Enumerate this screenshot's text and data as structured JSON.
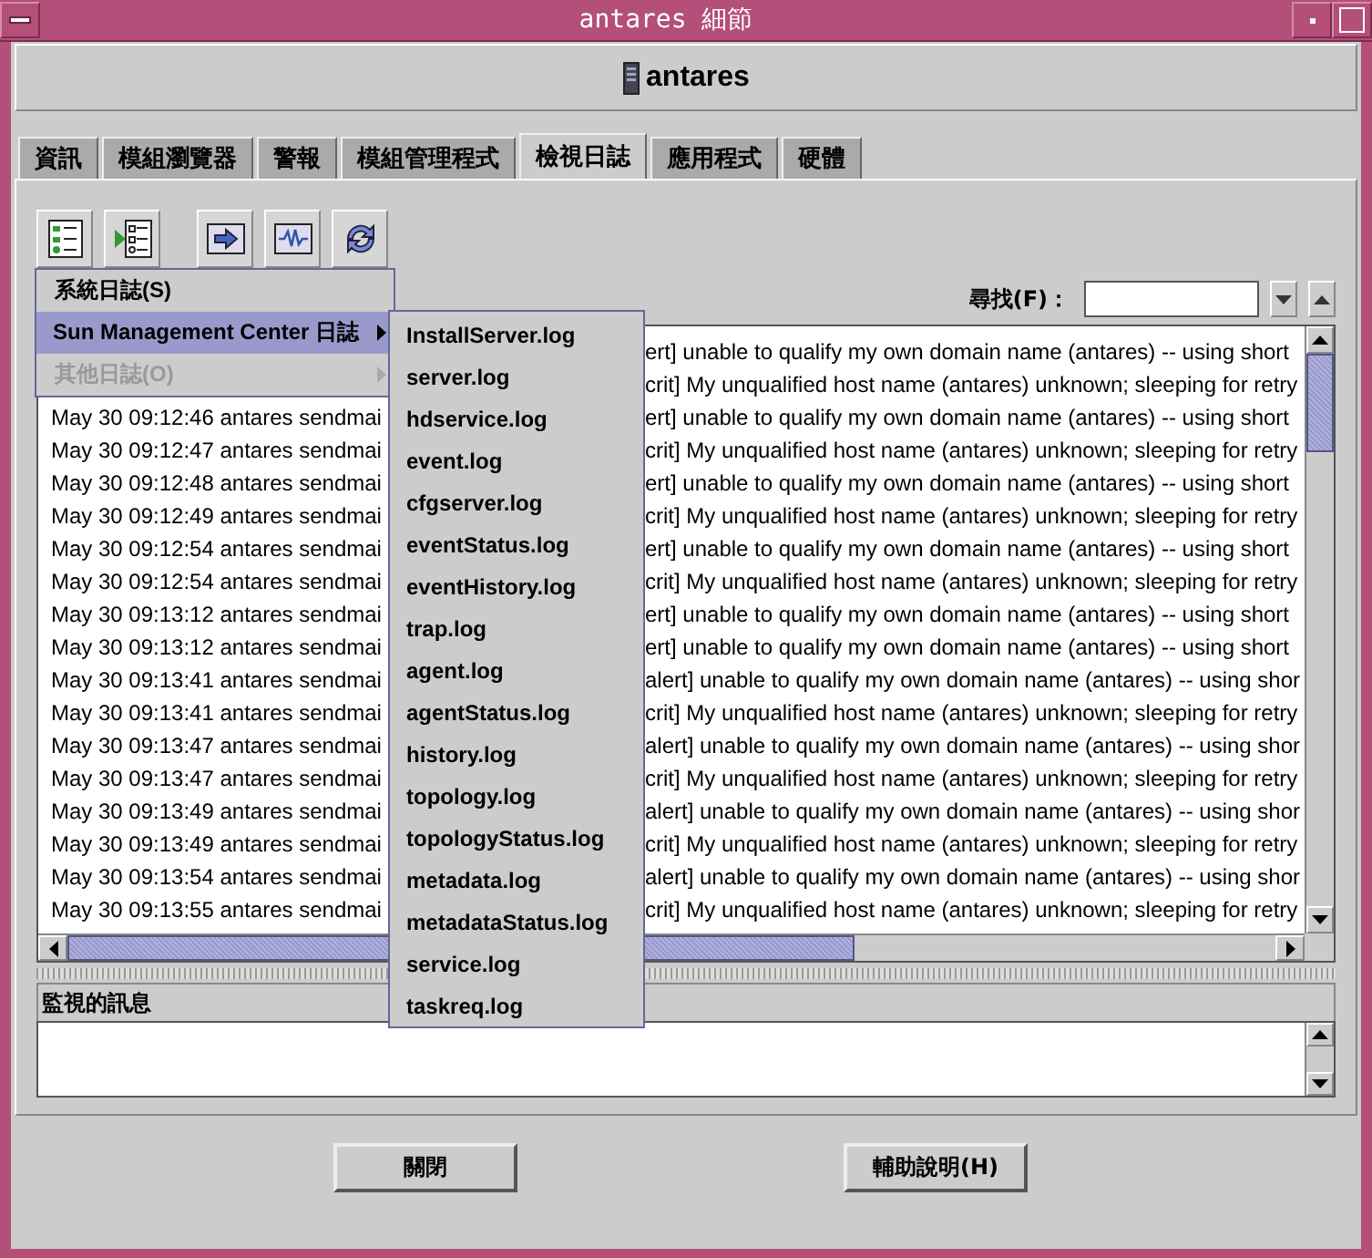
{
  "window": {
    "title": "antares 細節"
  },
  "header": {
    "title": "antares"
  },
  "tabs": [
    {
      "label": "資訊",
      "selected": false
    },
    {
      "label": "模組瀏覽器",
      "selected": false
    },
    {
      "label": "警報",
      "selected": false
    },
    {
      "label": "模組管理程式",
      "selected": false
    },
    {
      "label": "檢視日誌",
      "selected": true
    },
    {
      "label": "應用程式",
      "selected": false
    },
    {
      "label": "硬體",
      "selected": false
    }
  ],
  "find": {
    "label": "尋找(F)："
  },
  "log": {
    "rows": [
      {
        "right": "ert] unable to qualify my own domain name (antares) -- using short"
      },
      {
        "right": "crit] My unqualified host name (antares) unknown; sleeping for retry"
      },
      {
        "left": "May 30 09:12:46 antares sendmai",
        "right": "ert] unable to qualify my own domain name (antares) -- using short"
      },
      {
        "left": "May 30 09:12:47 antares sendmai",
        "right": "crit] My unqualified host name (antares) unknown; sleeping for retry"
      },
      {
        "left": "May 30 09:12:48 antares sendmai",
        "right": "ert] unable to qualify my own domain name (antares) -- using short"
      },
      {
        "left": "May 30 09:12:49 antares sendmai",
        "right": "crit] My unqualified host name (antares) unknown; sleeping for retry"
      },
      {
        "left": "May 30 09:12:54 antares sendmai",
        "right": "ert] unable to qualify my own domain name (antares) -- using short"
      },
      {
        "left": "May 30 09:12:54 antares sendmai",
        "right": "crit] My unqualified host name (antares) unknown; sleeping for retry"
      },
      {
        "left": "May 30 09:13:12 antares sendmai",
        "right": "ert] unable to qualify my own domain name (antares) -- using short"
      },
      {
        "left": "May 30 09:13:12 antares sendmai",
        "right": "ert] unable to qualify my own domain name (antares) -- using short"
      },
      {
        "left": "May 30 09:13:41 antares sendmai",
        "right": "alert] unable to qualify my own domain name (antares) -- using shor"
      },
      {
        "left": "May 30 09:13:41 antares sendmai",
        "right": "crit] My unqualified host name (antares) unknown; sleeping for retry"
      },
      {
        "left": "May 30 09:13:47 antares sendmai",
        "right": "alert] unable to qualify my own domain name (antares) -- using shor"
      },
      {
        "left": "May 30 09:13:47 antares sendmai",
        "right": "crit] My unqualified host name (antares) unknown; sleeping for retry"
      },
      {
        "left": "May 30 09:13:49 antares sendmai",
        "right": "alert] unable to qualify my own domain name (antares) -- using shor"
      },
      {
        "left": "May 30 09:13:49 antares sendmai",
        "right": "crit] My unqualified host name (antares) unknown; sleeping for retry"
      },
      {
        "left": "May 30 09:13:54 antares sendmai",
        "right": "alert] unable to qualify my own domain name (antares) -- using shor"
      },
      {
        "left": "May 30 09:13:55 antares sendmai",
        "right": "crit] My unqualified host name (antares) unknown; sleeping for retry"
      }
    ]
  },
  "menu": {
    "items": [
      {
        "label": "系統日誌(S)",
        "selected": false,
        "disabled": false,
        "submenu": false
      },
      {
        "label": "Sun Management Center 日誌",
        "selected": true,
        "disabled": false,
        "submenu": true
      },
      {
        "label": "其他日誌(O)",
        "selected": false,
        "disabled": true,
        "submenu": true
      }
    ]
  },
  "submenu": {
    "items": [
      "InstallServer.log",
      "server.log",
      "hdservice.log",
      "event.log",
      "cfgserver.log",
      "eventStatus.log",
      "eventHistory.log",
      "trap.log",
      "agent.log",
      "agentStatus.log",
      "history.log",
      "topology.log",
      "topologyStatus.log",
      "metadata.log",
      "metadataStatus.log",
      "service.log",
      "taskreq.log"
    ]
  },
  "messages": {
    "label": "監視的訊息"
  },
  "buttons": [
    "關閉",
    "輔助說明(H)"
  ]
}
